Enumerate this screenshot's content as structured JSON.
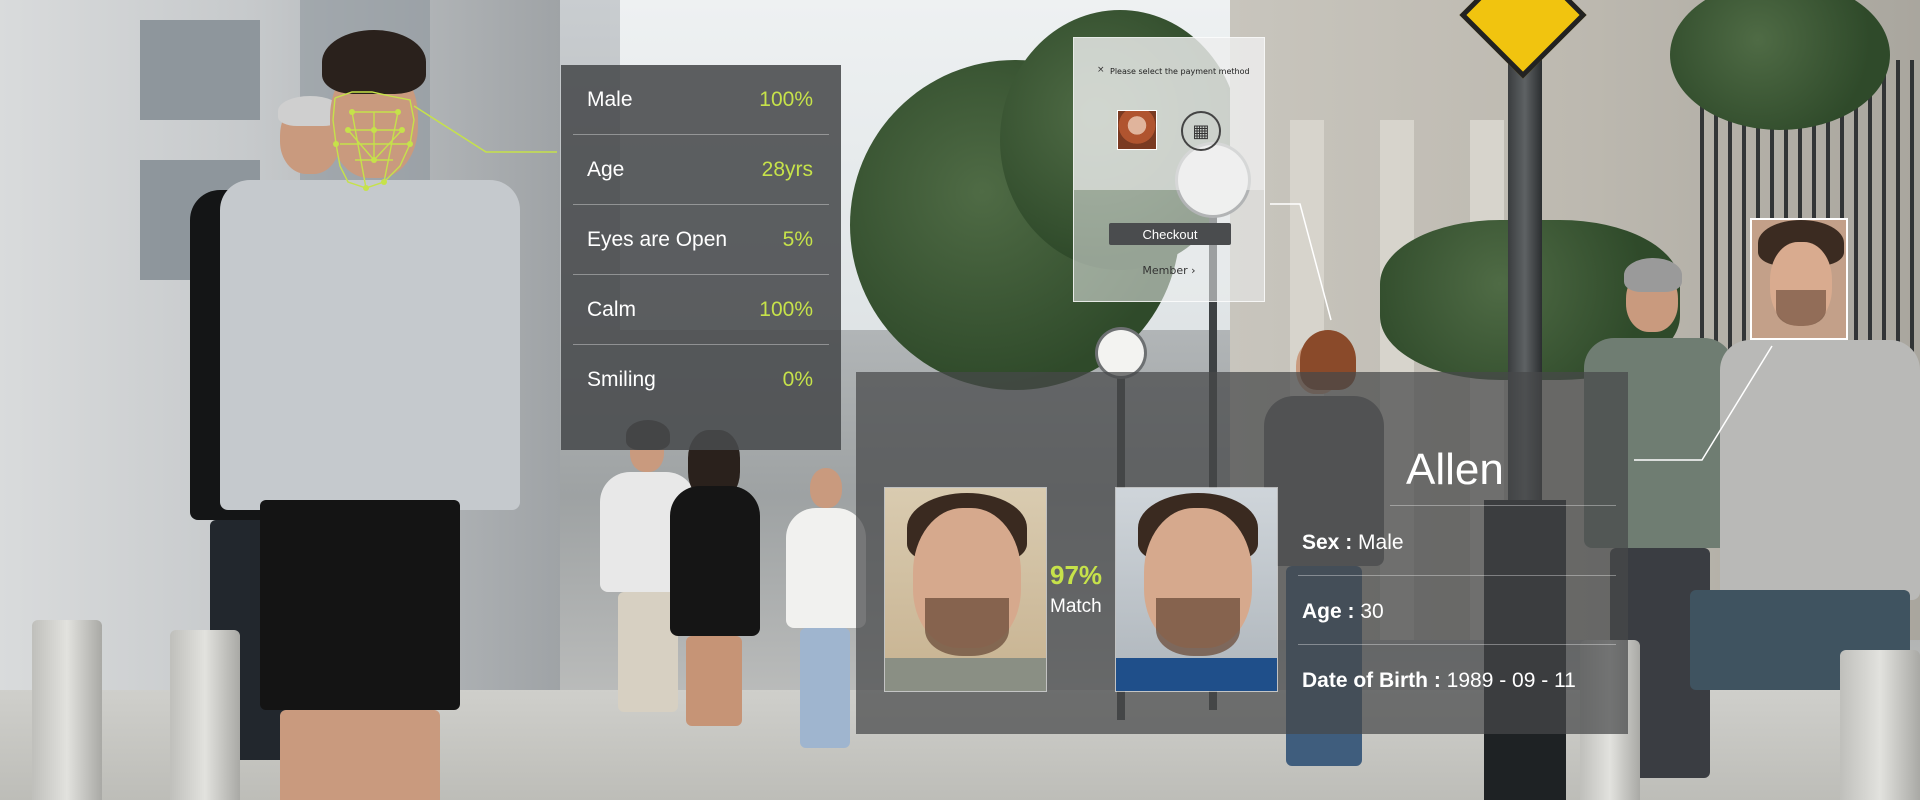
{
  "attributes": {
    "rows": [
      {
        "label": "Male",
        "value": "100%"
      },
      {
        "label": "Age",
        "value": "28yrs"
      },
      {
        "label": "Eyes are Open",
        "value": "5%"
      },
      {
        "label": "Calm",
        "value": "100%"
      },
      {
        "label": "Smiling",
        "value": "0%"
      }
    ],
    "accent_color": "#c6e24a"
  },
  "payment": {
    "close_icon": "×",
    "message": "Please select the payment method",
    "checkout_label": "Checkout",
    "member_label": "Member",
    "qr_icon": "qr-code-icon",
    "avatar_icon": "user-avatar"
  },
  "match": {
    "percent": "97%",
    "label": "Match"
  },
  "identity": {
    "name": "Allen",
    "fields": [
      {
        "key": "Sex :",
        "value": " Male"
      },
      {
        "key": "Age :",
        "value": " 30"
      },
      {
        "key": "Date of Birth :",
        "value": " 1989 - 09 - 11"
      }
    ]
  },
  "colors": {
    "panel_bg": "#4a4c4e",
    "accent": "#c6e24a",
    "text": "#ffffff"
  }
}
